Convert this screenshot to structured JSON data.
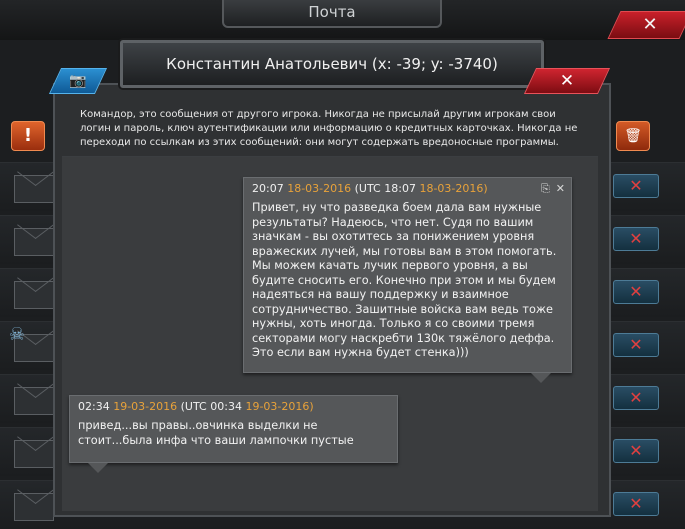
{
  "background": {
    "title": "Почта",
    "close_glyph": "✕",
    "alert_glyph": "!",
    "trash_glyph": "🗑",
    "row_delete_glyph": "✕",
    "skull_glyph": "☠"
  },
  "dialog": {
    "title": "Константин Анатольевич (x: -39; y: -3740)",
    "close_glyph": "✕",
    "camera_glyph": "📷",
    "warning": "Командор, это сообщения от другого игрока. Никогда не присылай другим игрокам свои логин и пароль, ключ аутентификации или информацию о кредитных карточках. Никогда не переходи по ссылкам из этих сообщений: они могут содержать вредоносные программы."
  },
  "messages": [
    {
      "time": "20:07",
      "date": "18-03-2016",
      "utc_label": "(UTC",
      "utc_time": "18:07",
      "utc_date": "18-03-2016)",
      "copy_glyph": "⎘",
      "delete_glyph": "✕",
      "text": "Привет, ну что разведка боем дала вам нужные результаты? Надеюсь, что нет. Судя по вашим значкам - вы охотитесь за понижением уровня вражеских лучей, мы готовы вам в этом помогать. Мы можем качать лучик первого уровня, а вы будите сносить его. Конечно при этом и мы будем надеяться на вашу поддержку и взаимное сотрудничество. Зашитные войска вам ведь тоже нужны, хоть иногда. Только я со своими тремя секторами могу наскребти 130к тяжёлого деффа. Это если вам нужна будет стенка)))"
    },
    {
      "time": "02:34",
      "date": "19-03-2016",
      "utc_label": "(UTC",
      "utc_time": "00:34",
      "utc_date": "19-03-2016)",
      "text": "привед...вы правы..овчинка выделки не стоит...была инфа что ваши лампочки пустые"
    }
  ],
  "colors": {
    "date_accent": "#e8a23a",
    "close_red": "#cf2530",
    "camera_blue": "#2b8fd1"
  }
}
